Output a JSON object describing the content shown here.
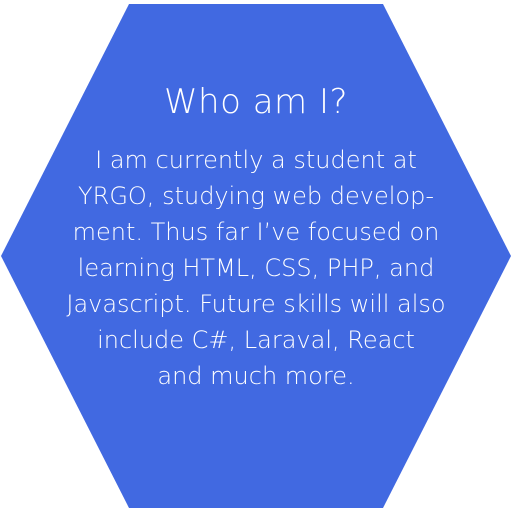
{
  "card": {
    "title": "Who am I?",
    "body_lines": [
      "I am currently a student at",
      "YRGO, studying web develop-",
      "ment. Thus far I’ve focused on",
      "learning HTML, CSS, PHP, and",
      "Javascript. Future skills will also",
      "include C#, Laraval, React",
      "and much more."
    ]
  },
  "colors": {
    "hexagon_fill": "#4169E1",
    "text": "#ffffff",
    "background": "#ffffff"
  }
}
